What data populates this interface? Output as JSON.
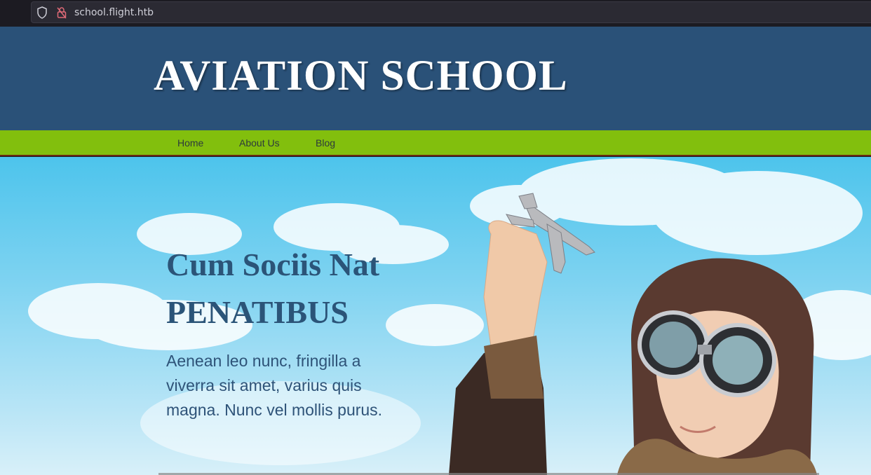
{
  "browser": {
    "url": "school.flight.htb"
  },
  "header": {
    "site_title": "AVIATION SCHOOL"
  },
  "nav": {
    "items": [
      {
        "label": "Home"
      },
      {
        "label": "About Us"
      },
      {
        "label": "Blog"
      }
    ]
  },
  "hero": {
    "title_line1": "Cum Sociis Nat",
    "title_line2": "PENATIBUS",
    "text": "Aenean leo nunc, fringilla a viverra sit amet, varius quis magna. Nunc vel mollis purus."
  },
  "colors": {
    "header_bg": "#2a5178",
    "nav_bg": "#82bf0d",
    "hero_text": "#2b5478"
  }
}
